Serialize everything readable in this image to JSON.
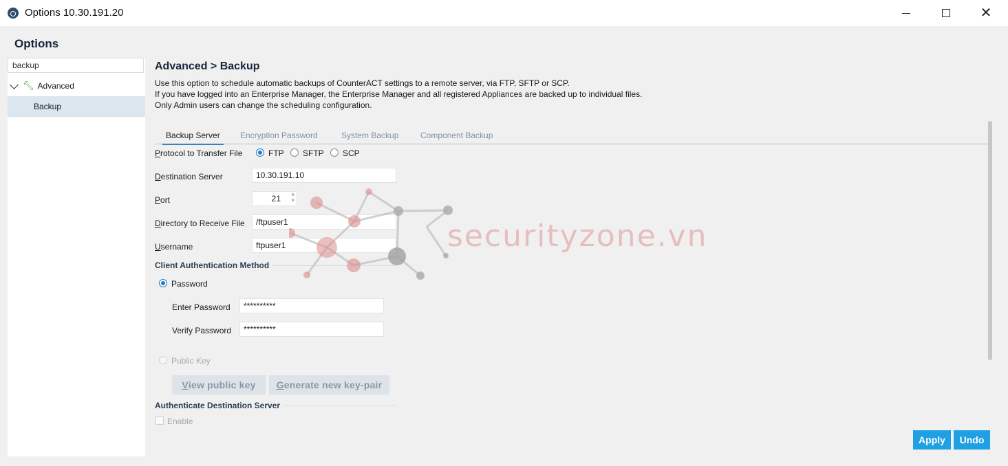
{
  "window": {
    "title": "Options 10.30.191.20",
    "minimize_glyph": "",
    "close_glyph": "✕"
  },
  "heading": "Options",
  "nav": {
    "search_value": "backup",
    "items": [
      {
        "label": "Advanced",
        "icon": "wrench-icon"
      },
      {
        "label": "Backup",
        "selected": true
      }
    ]
  },
  "content": {
    "breadcrumb": "Advanced > Backup",
    "description": [
      "Use this option to schedule automatic backups of CounterACT settings to a remote server, via FTP, SFTP or SCP.",
      "If you have logged into an Enterprise Manager, the Enterprise Manager and all registered Appliances are backed up to individual files.",
      "Only Admin users can change the scheduling configuration."
    ],
    "tabs": [
      "Backup Server",
      "Encryption Password",
      "System Backup",
      "Component Backup"
    ],
    "active_tab": "Backup Server",
    "form": {
      "protocol_label_u": "P",
      "protocol_label_rest": "rotocol to Transfer File",
      "protocols": [
        "FTP",
        "SFTP",
        "SCP"
      ],
      "selected_protocol": "FTP",
      "destination_label_u": "D",
      "destination_label_rest": "estination Server",
      "destination_value": "10.30.191.10",
      "port_label_u": "P",
      "port_label_rest": "ort",
      "port_value": "21",
      "directory_label_u": "D",
      "directory_label_rest": "irectory to Receive File",
      "directory_value": "/ftpuser1",
      "username_label_u": "U",
      "username_label_rest": "sername",
      "username_value": "ftpuser1",
      "client_auth_title": "Client Authentication Method",
      "password_option": "Password",
      "enter_password_label": "Enter Password",
      "enter_password_value": "**********",
      "verify_password_label": "Verify Password",
      "verify_password_value": "**********",
      "public_key_option": "Public Key",
      "view_key_u": "V",
      "view_key_rest": "iew public key",
      "generate_key_u": "G",
      "generate_key_rest": "enerate new key-pair",
      "auth_dest_title": "Authenticate Destination Server",
      "enable_label": "Enable"
    }
  },
  "footer": {
    "apply": "Apply",
    "undo": "Undo"
  },
  "watermark": {
    "text": "securityzone.vn"
  },
  "colors": {
    "accent": "#1fa0e3",
    "selected_nav": "#dbe6ef",
    "heading": "#16263a"
  }
}
